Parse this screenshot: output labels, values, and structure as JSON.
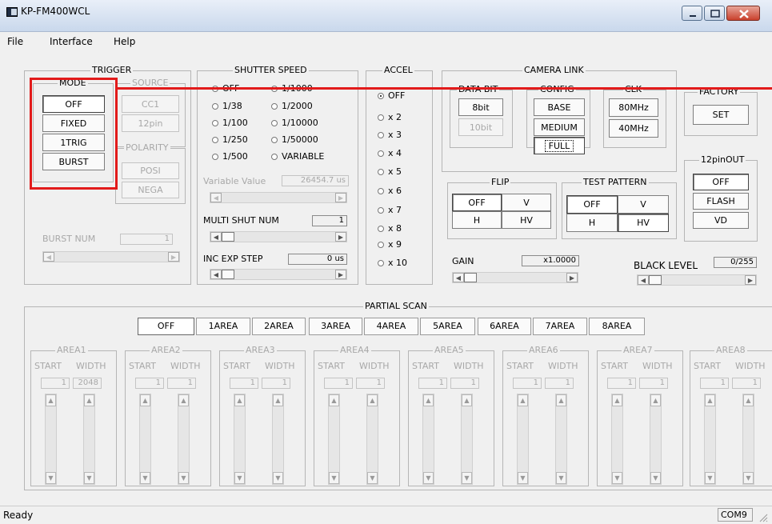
{
  "window": {
    "title": "KP-FM400WCL"
  },
  "menu": [
    "File",
    "Interface",
    "Help"
  ],
  "trigger": {
    "title": "TRIGGER",
    "mode": {
      "title": "MODE",
      "buttons": [
        "OFF",
        "FIXED",
        "1TRIG",
        "BURST"
      ]
    },
    "source": {
      "title": "SOURCE",
      "buttons": [
        "CC1",
        "12pin"
      ]
    },
    "polarity": {
      "title": "POLARITY",
      "buttons": [
        "POSI",
        "NEGA"
      ]
    },
    "burst_num_label": "BURST NUM",
    "burst_num_value": "1"
  },
  "shutter": {
    "title": "SHUTTER SPEED",
    "left_options": [
      "OFF",
      "1/38",
      "1/100",
      "1/250",
      "1/500"
    ],
    "right_options": [
      "1/1000",
      "1/2000",
      "1/10000",
      "1/50000",
      "VARIABLE"
    ],
    "selected": "OFF",
    "variable_label": "Variable Value",
    "variable_value": "26454.7 us",
    "multi_label": "MULTI SHUT NUM",
    "multi_value": "1",
    "inc_label": "INC EXP STEP",
    "inc_value": "0 us"
  },
  "accel": {
    "title": "ACCEL",
    "options": [
      "OFF",
      "x 2",
      "x 3",
      "x 4",
      "x 5",
      "x 6",
      "x 7",
      "x 8",
      "x 9",
      "x 10"
    ],
    "selected": "OFF"
  },
  "camera_link": {
    "title": "CAMERA LINK",
    "data_bit": {
      "title": "DATA BIT",
      "buttons": [
        "8bit",
        "10bit"
      ]
    },
    "config": {
      "title": "CONFIG",
      "buttons": [
        "BASE",
        "MEDIUM",
        "FULL"
      ]
    },
    "clk": {
      "title": "CLK",
      "buttons": [
        "80MHz",
        "40MHz"
      ]
    }
  },
  "factory": {
    "title": "FACTORY",
    "button": "SET"
  },
  "pin12out": {
    "title": "12pinOUT",
    "buttons": [
      "OFF",
      "FLASH",
      "VD"
    ]
  },
  "flip": {
    "title": "FLIP",
    "buttons": [
      "OFF",
      "V",
      "H",
      "HV"
    ]
  },
  "test_pattern": {
    "title": "TEST PATTERN",
    "buttons": [
      "OFF",
      "V",
      "H",
      "HV"
    ]
  },
  "gain": {
    "label": "GAIN",
    "value": "x1.0000"
  },
  "black_level": {
    "label": "BLACK LEVEL",
    "value": "0/255"
  },
  "partial_scan": {
    "title": "PARTIAL SCAN",
    "tabs": [
      "OFF",
      "1AREA",
      "2AREA",
      "3AREA",
      "4AREA",
      "5AREA",
      "6AREA",
      "7AREA",
      "8AREA"
    ],
    "selected_tab": "OFF",
    "areas": [
      {
        "title": "AREA1",
        "start": "1",
        "width": "2048"
      },
      {
        "title": "AREA2",
        "start": "1",
        "width": "1"
      },
      {
        "title": "AREA3",
        "start": "1",
        "width": "1"
      },
      {
        "title": "AREA4",
        "start": "1",
        "width": "1"
      },
      {
        "title": "AREA5",
        "start": "1",
        "width": "1"
      },
      {
        "title": "AREA6",
        "start": "1",
        "width": "1"
      },
      {
        "title": "AREA7",
        "start": "1",
        "width": "1"
      },
      {
        "title": "AREA8",
        "start": "1",
        "width": "1"
      }
    ],
    "start_label": "START",
    "width_label": "WIDTH"
  },
  "status": {
    "text": "Ready",
    "port": "COM9"
  },
  "colors": {
    "highlight": "#e21b1b",
    "face": "#f0f0f0"
  }
}
